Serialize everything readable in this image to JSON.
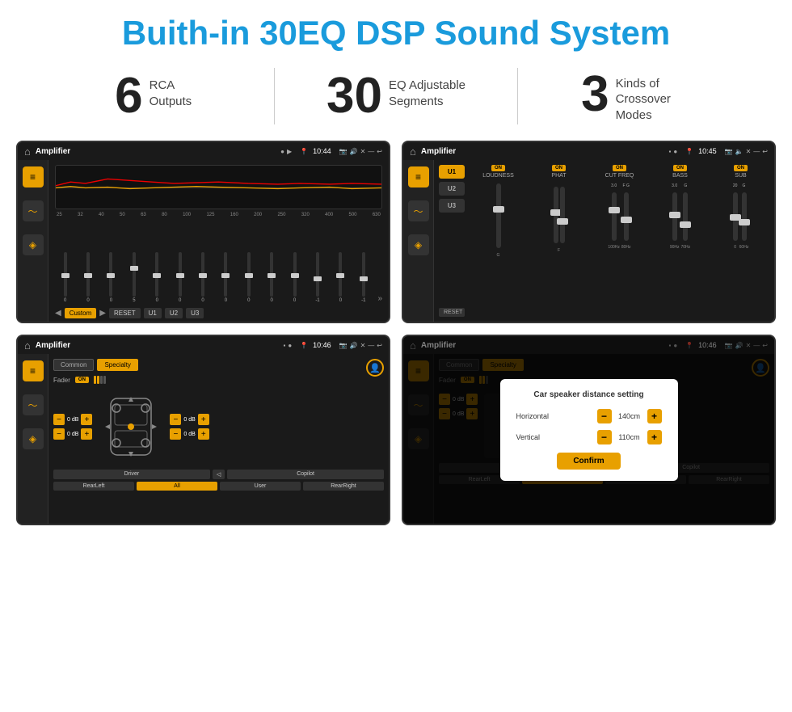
{
  "header": {
    "title": "Buith-in 30EQ DSP Sound System"
  },
  "stats": [
    {
      "number": "6",
      "label": "RCA\nOutputs"
    },
    {
      "number": "30",
      "label": "EQ Adjustable\nSegments"
    },
    {
      "number": "3",
      "label": "Kinds of\nCrossover Modes"
    }
  ],
  "screens": [
    {
      "id": "screen1",
      "statusBar": {
        "title": "Amplifier",
        "time": "10:44"
      },
      "type": "eq"
    },
    {
      "id": "screen2",
      "statusBar": {
        "title": "Amplifier",
        "time": "10:45"
      },
      "type": "crossover"
    },
    {
      "id": "screen3",
      "statusBar": {
        "title": "Amplifier",
        "time": "10:46"
      },
      "type": "specialty"
    },
    {
      "id": "screen4",
      "statusBar": {
        "title": "Amplifier",
        "time": "10:46"
      },
      "type": "dialog"
    }
  ],
  "eq": {
    "freqLabels": [
      "25",
      "32",
      "40",
      "50",
      "63",
      "80",
      "100",
      "125",
      "160",
      "200",
      "250",
      "320",
      "400",
      "500",
      "630"
    ],
    "sliders": [
      {
        "value": "0",
        "pos": 50
      },
      {
        "value": "0",
        "pos": 50
      },
      {
        "value": "0",
        "pos": 50
      },
      {
        "value": "5",
        "pos": 35
      },
      {
        "value": "0",
        "pos": 50
      },
      {
        "value": "0",
        "pos": 50
      },
      {
        "value": "0",
        "pos": 50
      },
      {
        "value": "0",
        "pos": 50
      },
      {
        "value": "0",
        "pos": 50
      },
      {
        "value": "0",
        "pos": 50
      },
      {
        "value": "0",
        "pos": 50
      },
      {
        "value": "-1",
        "pos": 55
      },
      {
        "value": "0",
        "pos": 50
      },
      {
        "value": "-1",
        "pos": 55
      }
    ],
    "buttons": [
      "Custom",
      "RESET",
      "U1",
      "U2",
      "U3"
    ]
  },
  "crossover": {
    "presets": [
      "U1",
      "U2",
      "U3"
    ],
    "channels": [
      {
        "label": "LOUDNESS",
        "on": true
      },
      {
        "label": "PHAT",
        "on": true
      },
      {
        "label": "CUT FREQ",
        "on": true
      },
      {
        "label": "BASS",
        "on": true
      },
      {
        "label": "SUB",
        "on": true
      }
    ]
  },
  "specialty": {
    "tabs": [
      "Common",
      "Specialty"
    ],
    "activeTab": "Specialty",
    "fader": {
      "label": "Fader",
      "on": true
    },
    "controls": [
      {
        "label": "0 dB",
        "active": false
      },
      {
        "label": "0 dB",
        "active": false
      },
      {
        "label": "0 dB",
        "active": false
      },
      {
        "label": "0 dB",
        "active": false
      }
    ],
    "bottomBtns": [
      "Driver",
      "",
      "Copilot",
      "RearLeft",
      "All",
      "User",
      "RearRight"
    ]
  },
  "dialog": {
    "title": "Car speaker distance setting",
    "horizontal": {
      "label": "Horizontal",
      "value": "140cm"
    },
    "vertical": {
      "label": "Vertical",
      "value": "110cm"
    },
    "confirmLabel": "Confirm",
    "rightControls": [
      {
        "label": "0 dB"
      },
      {
        "label": "0 dB"
      }
    ]
  }
}
